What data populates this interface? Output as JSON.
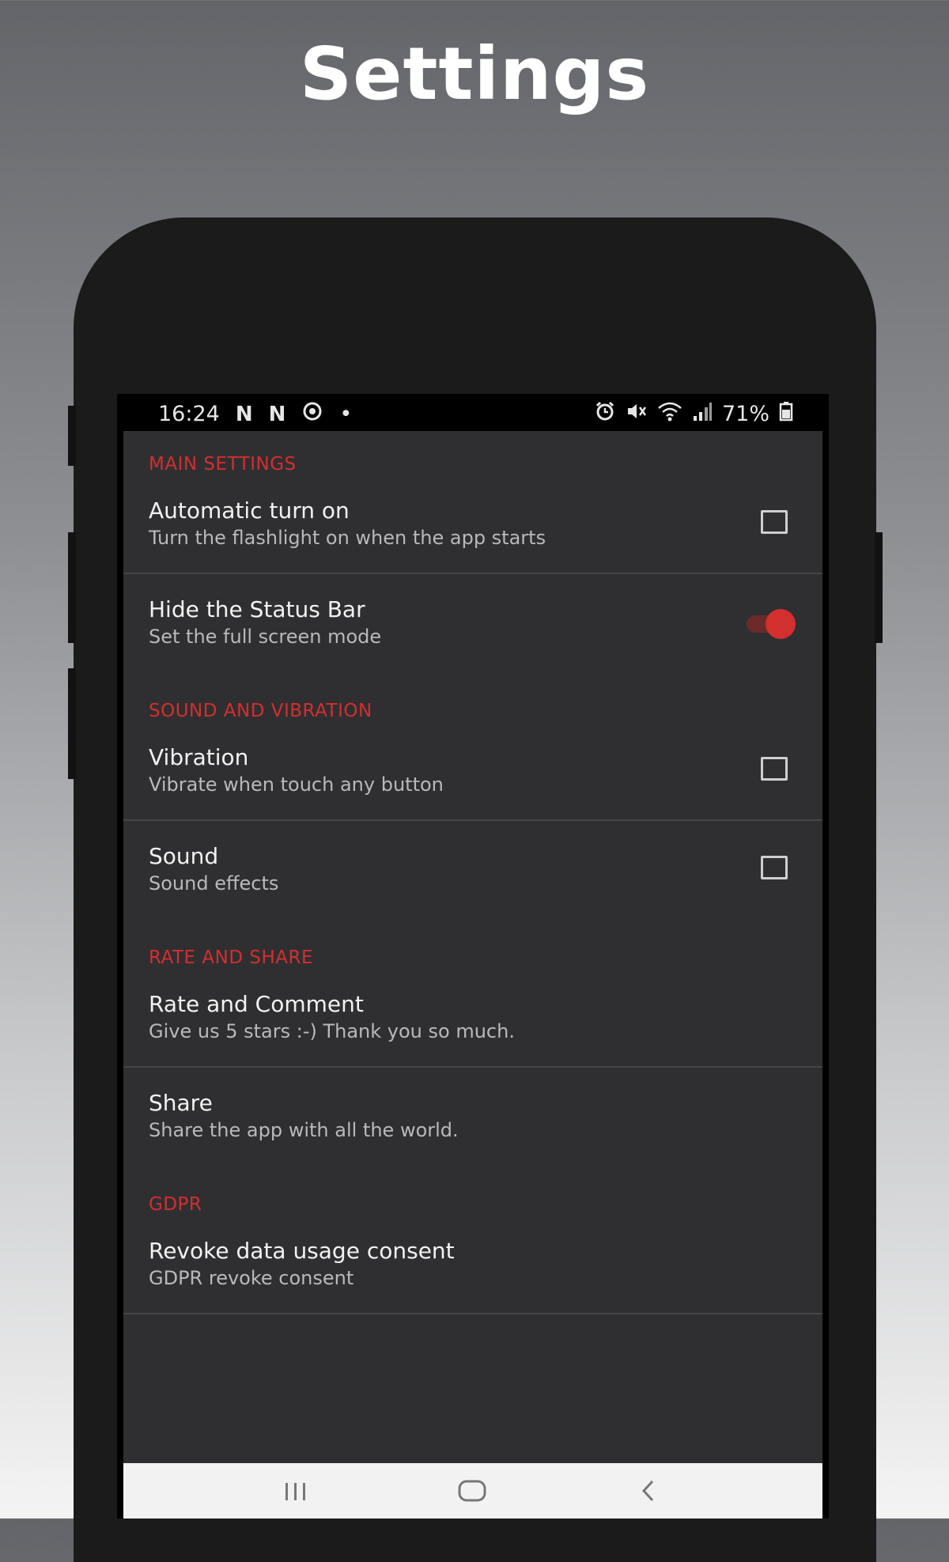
{
  "headline": "Settings",
  "status_bar": {
    "time": "16:24",
    "notif_1": "N",
    "notif_2": "N",
    "dot": "•",
    "battery": "71%"
  },
  "sections": [
    {
      "header": "MAIN SETTINGS",
      "items": [
        {
          "title": "Automatic turn on",
          "subtitle": "Turn the flashlight on when the app starts",
          "control": "checkbox",
          "checked": false
        },
        {
          "title": "Hide the Status Bar",
          "subtitle": "Set the full screen mode",
          "control": "switch",
          "checked": true
        }
      ]
    },
    {
      "header": "SOUND AND VIBRATION",
      "items": [
        {
          "title": "Vibration",
          "subtitle": "Vibrate when touch any button",
          "control": "checkbox",
          "checked": false
        },
        {
          "title": "Sound",
          "subtitle": "Sound effects",
          "control": "checkbox",
          "checked": false
        }
      ]
    },
    {
      "header": "RATE AND SHARE",
      "items": [
        {
          "title": "Rate and Comment",
          "subtitle": "Give us 5 stars :-) Thank you so much.",
          "control": "none"
        },
        {
          "title": "Share",
          "subtitle": "Share the app with all the world.",
          "control": "none"
        }
      ]
    },
    {
      "header": "GDPR",
      "items": [
        {
          "title": "Revoke data usage consent",
          "subtitle": "GDPR revoke consent",
          "control": "none"
        }
      ]
    }
  ],
  "colors": {
    "accent": "#d32f2f",
    "background": "#2f2f31",
    "text_primary": "#f2f2f2",
    "text_secondary": "#b9b9bb"
  },
  "nav_icons": [
    "recent-apps-icon",
    "home-icon",
    "back-icon"
  ]
}
